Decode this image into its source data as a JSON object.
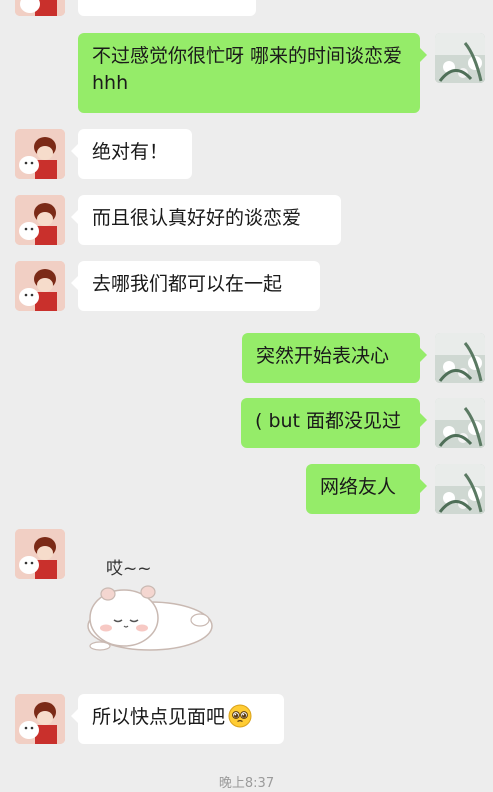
{
  "chat": {
    "messages": [
      {
        "sender": "me",
        "text": "不过感觉你很忙呀 哪来的时间谈恋爱 hhh"
      },
      {
        "sender": "friend",
        "text": "绝对有！"
      },
      {
        "sender": "friend",
        "text": "而且很认真好好的谈恋爱"
      },
      {
        "sender": "friend",
        "text": "去哪我们都可以在一起"
      },
      {
        "sender": "me",
        "text": "突然开始表决心"
      },
      {
        "sender": "me",
        "text": "( but 面都没见过"
      },
      {
        "sender": "me",
        "text": "网络友人"
      },
      {
        "sender": "friend",
        "type": "sticker",
        "text": "哎~~"
      },
      {
        "sender": "friend",
        "text": "所以快点见面吧",
        "emoji": "pleading-face"
      }
    ],
    "timestamp": "晚上8:37"
  },
  "colors": {
    "background": "#ededed",
    "outgoing_bubble": "#95ec69",
    "incoming_bubble": "#ffffff",
    "timestamp_text": "#9b9b9b"
  }
}
